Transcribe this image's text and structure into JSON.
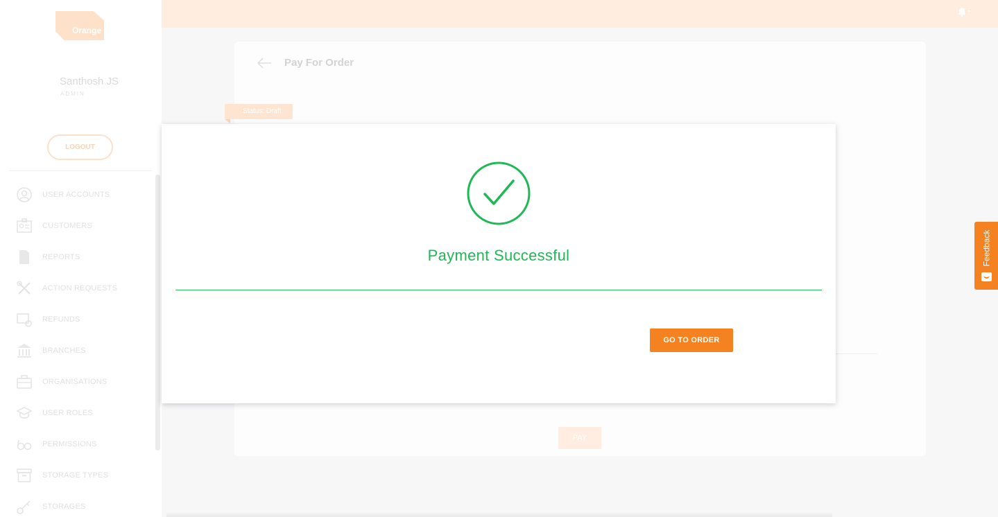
{
  "sidebar": {
    "logo": {
      "word": "Orange",
      "sub": ""
    },
    "user": {
      "name": "Santhosh JS",
      "role": "ADMIN"
    },
    "logout_label": "LOGOUT",
    "items": [
      {
        "label": "USER ACCOUNTS",
        "icon": "user-circle-icon"
      },
      {
        "label": "CUSTOMERS",
        "icon": "id-card-icon"
      },
      {
        "label": "REPORTS",
        "icon": "file-icon"
      },
      {
        "label": "ACTION REQUESTS",
        "icon": "tools-icon"
      },
      {
        "label": "REFUNDS",
        "icon": "refund-icon"
      },
      {
        "label": "BRANCHES",
        "icon": "bank-icon"
      },
      {
        "label": "ORGANISATIONS",
        "icon": "briefcase-icon"
      },
      {
        "label": "USER ROLES",
        "icon": "graduation-cap-icon"
      },
      {
        "label": "PERMISSIONS",
        "icon": "glasses-icon"
      },
      {
        "label": "STORAGE TYPES",
        "icon": "archive-icon"
      },
      {
        "label": "STORAGES",
        "icon": "key-icon"
      }
    ]
  },
  "topbar": {
    "notification_icon": "bell-icon"
  },
  "page": {
    "title": "Pay For Order",
    "status": "Status: Draft",
    "pay_label": "PAY"
  },
  "modal": {
    "title": "Payment Successful",
    "button_label": "GO TO ORDER"
  },
  "feedback": {
    "label": "Feedback"
  },
  "colors": {
    "accent": "#f58220",
    "success": "#1eb854",
    "topbar": "#ffeedf"
  }
}
